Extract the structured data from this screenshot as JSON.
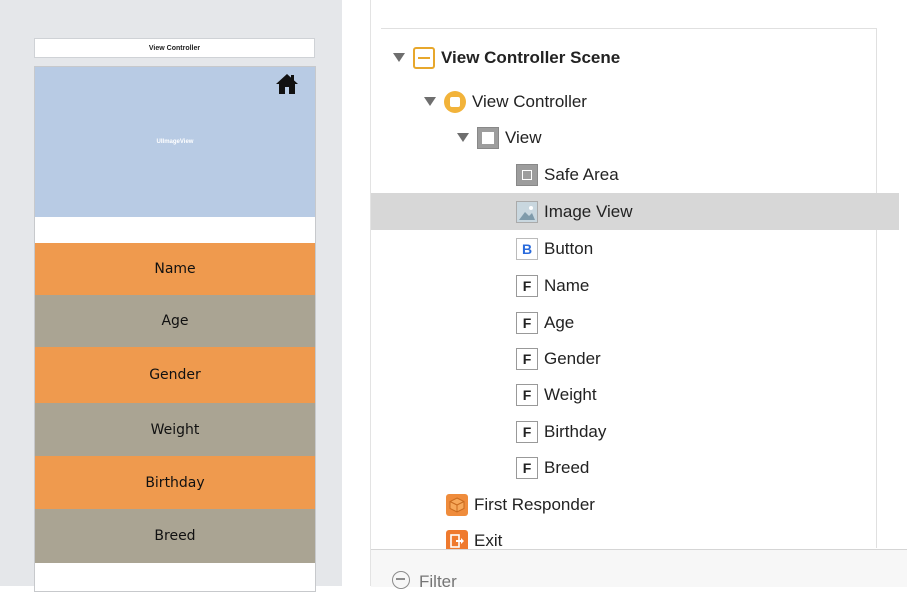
{
  "canvas": {
    "vc_title": "View Controller",
    "image_label": "UIImageView",
    "fields": [
      {
        "label": "Name",
        "color": "#ef9a4e"
      },
      {
        "label": "Age",
        "color": "#aaa493"
      },
      {
        "label": "Gender",
        "color": "#ef9a4e"
      },
      {
        "label": "Weight",
        "color": "#aaa493"
      },
      {
        "label": "Birthday",
        "color": "#ef9a4e"
      },
      {
        "label": "Breed",
        "color": "#aaa493"
      }
    ],
    "home_icon": "house-icon",
    "image_bg_color": "#b8cbe4"
  },
  "outline": {
    "scene": {
      "label": "View Controller Scene",
      "icon": "scene-icon"
    },
    "view_controller": {
      "label": "View Controller",
      "icon": "view-controller-icon"
    },
    "view": {
      "label": "View",
      "icon": "view-icon"
    },
    "children": [
      {
        "label": "Safe Area",
        "icon": "safe-area-icon",
        "glyph": ""
      },
      {
        "label": "Image View",
        "icon": "image-view-icon",
        "glyph": "",
        "selected": true
      },
      {
        "label": "Button",
        "icon": "button-icon",
        "glyph": "B"
      },
      {
        "label": "Name",
        "icon": "text-field-icon",
        "glyph": "F"
      },
      {
        "label": "Age",
        "icon": "text-field-icon",
        "glyph": "F"
      },
      {
        "label": "Gender",
        "icon": "text-field-icon",
        "glyph": "F"
      },
      {
        "label": "Weight",
        "icon": "text-field-icon",
        "glyph": "F"
      },
      {
        "label": "Birthday",
        "icon": "text-field-icon",
        "glyph": "F"
      },
      {
        "label": "Breed",
        "icon": "text-field-icon",
        "glyph": "F"
      }
    ],
    "first_responder": {
      "label": "First Responder",
      "icon": "first-responder-icon"
    },
    "exit": {
      "label": "Exit",
      "icon": "exit-icon"
    },
    "filter_placeholder": "Filter",
    "selected_color": "#d7d7d7"
  }
}
